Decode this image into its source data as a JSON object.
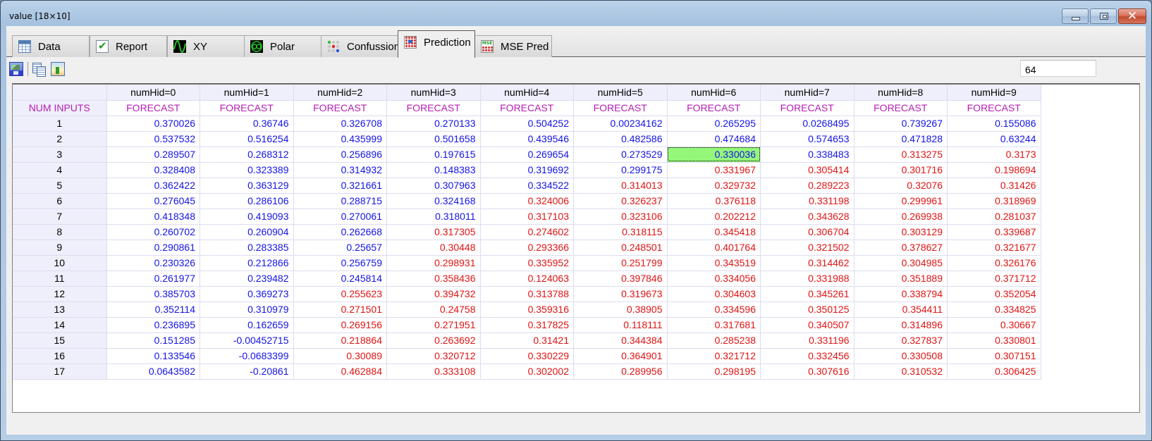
{
  "window": {
    "title": "value [18×10]",
    "controls": {
      "minimize": "minimize",
      "maximize": "maximize",
      "close": "✕"
    }
  },
  "tabs": [
    {
      "label": "Data",
      "icon": "table-icon",
      "active": false
    },
    {
      "label": "Report",
      "icon": "checkbox-icon",
      "active": false
    },
    {
      "label": "XY",
      "icon": "sine-wave-icon",
      "active": false
    },
    {
      "label": "Polar",
      "icon": "polar-icon",
      "active": false
    },
    {
      "label": "Confussion",
      "icon": "confusion-matrix-icon",
      "active": false
    },
    {
      "label": "Prediction",
      "icon": "prediction-grid-icon",
      "active": true
    },
    {
      "label": "MSE Pred",
      "icon": "mse-grid-icon",
      "active": false
    }
  ],
  "toolbar": {
    "buttons": [
      {
        "name": "save-image-button",
        "icon": "save-image-icon"
      },
      {
        "name": "copy-button",
        "icon": "copy-icon"
      },
      {
        "name": "export-image-button",
        "icon": "export-image-icon"
      }
    ],
    "page_value": "64"
  },
  "colors": {
    "below_threshold": "#1414e6",
    "above_threshold": "#e01414",
    "header_sub": "#b41fb4",
    "selected_cell": "#95f77a"
  },
  "grid": {
    "row_header_title": "NUM INPUTS",
    "columns": [
      "numHid=0",
      "numHid=1",
      "numHid=2",
      "numHid=3",
      "numHid=4",
      "numHid=5",
      "numHid=6",
      "numHid=7",
      "numHid=8",
      "numHid=9"
    ],
    "sub_header": "FORECAST",
    "selected": {
      "row": 3,
      "col": 6
    },
    "blue_rows_per_column": [
      17,
      17,
      11,
      7,
      5,
      4,
      3,
      3,
      2,
      2
    ],
    "rows": [
      {
        "label": "1",
        "values": [
          "0.370026",
          "0.36746",
          "0.326708",
          "0.270133",
          "0.504252",
          "0.00234162",
          "0.265295",
          "0.0268495",
          "0.739267",
          "0.155086"
        ]
      },
      {
        "label": "2",
        "values": [
          "0.537532",
          "0.516254",
          "0.435999",
          "0.501658",
          "0.439546",
          "0.482586",
          "0.474684",
          "0.574653",
          "0.471828",
          "0.63244"
        ]
      },
      {
        "label": "3",
        "values": [
          "0.289507",
          "0.268312",
          "0.256896",
          "0.197615",
          "0.269654",
          "0.273529",
          "0.330036",
          "0.338483",
          "0.313275",
          "0.3173"
        ]
      },
      {
        "label": "4",
        "values": [
          "0.328408",
          "0.323389",
          "0.314932",
          "0.148383",
          "0.319692",
          "0.299175",
          "0.331967",
          "0.305414",
          "0.301716",
          "0.198694"
        ]
      },
      {
        "label": "5",
        "values": [
          "0.362422",
          "0.363129",
          "0.321661",
          "0.307963",
          "0.334522",
          "0.314013",
          "0.329732",
          "0.289223",
          "0.32076",
          "0.31426"
        ]
      },
      {
        "label": "6",
        "values": [
          "0.276045",
          "0.286106",
          "0.288715",
          "0.324168",
          "0.324006",
          "0.326237",
          "0.376118",
          "0.331198",
          "0.299961",
          "0.318969"
        ]
      },
      {
        "label": "7",
        "values": [
          "0.418348",
          "0.419093",
          "0.270061",
          "0.318011",
          "0.317103",
          "0.323106",
          "0.202212",
          "0.343628",
          "0.269938",
          "0.281037"
        ]
      },
      {
        "label": "8",
        "values": [
          "0.260702",
          "0.260904",
          "0.262668",
          "0.317305",
          "0.274602",
          "0.318115",
          "0.345418",
          "0.306704",
          "0.303129",
          "0.339687"
        ]
      },
      {
        "label": "9",
        "values": [
          "0.290861",
          "0.283385",
          "0.25657",
          "0.30448",
          "0.293366",
          "0.248501",
          "0.401764",
          "0.321502",
          "0.378627",
          "0.321677"
        ]
      },
      {
        "label": "10",
        "values": [
          "0.230326",
          "0.212866",
          "0.256759",
          "0.298931",
          "0.335952",
          "0.251799",
          "0.343519",
          "0.314462",
          "0.304985",
          "0.326176"
        ]
      },
      {
        "label": "11",
        "values": [
          "0.261977",
          "0.239482",
          "0.245814",
          "0.358436",
          "0.124063",
          "0.397846",
          "0.334056",
          "0.331988",
          "0.351889",
          "0.371712"
        ]
      },
      {
        "label": "12",
        "values": [
          "0.385703",
          "0.369273",
          "0.255623",
          "0.394732",
          "0.313788",
          "0.319673",
          "0.304603",
          "0.345261",
          "0.338794",
          "0.352054"
        ]
      },
      {
        "label": "13",
        "values": [
          "0.352114",
          "0.310979",
          "0.271501",
          "0.24758",
          "0.359316",
          "0.38905",
          "0.334596",
          "0.350125",
          "0.354411",
          "0.334825"
        ]
      },
      {
        "label": "14",
        "values": [
          "0.236895",
          "0.162659",
          "0.269156",
          "0.271951",
          "0.317825",
          "0.118111",
          "0.317681",
          "0.340507",
          "0.314896",
          "0.30667"
        ]
      },
      {
        "label": "15",
        "values": [
          "0.151285",
          "-0.00452715",
          "0.218864",
          "0.263692",
          "0.31421",
          "0.344384",
          "0.285238",
          "0.331196",
          "0.327837",
          "0.330801"
        ]
      },
      {
        "label": "16",
        "values": [
          "0.133546",
          "-0.0683399",
          "0.30089",
          "0.320712",
          "0.330229",
          "0.364901",
          "0.321712",
          "0.332456",
          "0.330508",
          "0.307151"
        ]
      },
      {
        "label": "17",
        "values": [
          "0.0643582",
          "-0.20861",
          "0.462884",
          "0.333108",
          "0.302002",
          "0.289956",
          "0.298195",
          "0.307616",
          "0.310532",
          "0.306425"
        ]
      }
    ]
  }
}
